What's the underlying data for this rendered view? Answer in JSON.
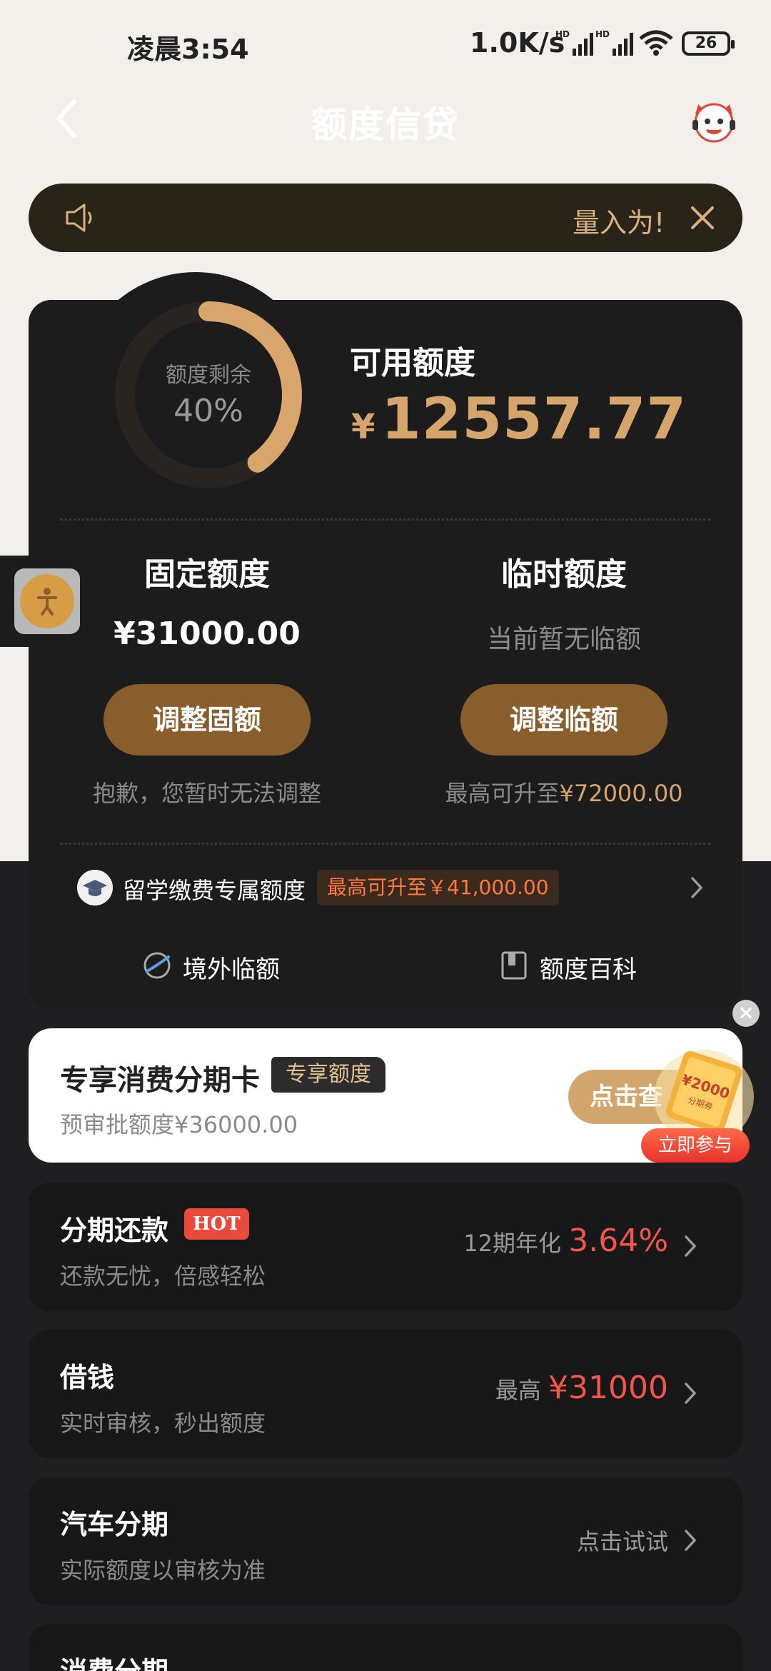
{
  "status_bar": {
    "time": "凌晨3:54",
    "network_speed": "1.0K/s",
    "battery": "26"
  },
  "header": {
    "title": "额度信贷"
  },
  "notice": {
    "text": "量入为!"
  },
  "credit": {
    "ring_label": "额度剩余",
    "ring_percent": "40%",
    "remaining_fraction": 0.4,
    "available_label": "可用额度",
    "currency_symbol": "¥",
    "available_amount": "12557.77"
  },
  "fixed_limit": {
    "title": "固定额度",
    "value": "¥31000.00",
    "button": "调整固额",
    "note": "抱歉，您暂时无法调整"
  },
  "temp_limit": {
    "title": "临时额度",
    "value": "当前暂无临额",
    "button": "调整临额",
    "note_prefix": "最高可升至",
    "note_amount": "¥72000.00"
  },
  "study_abroad": {
    "label": "留学缴费专属额度",
    "badge": "最高可升至￥41,000.00"
  },
  "quick_links": [
    {
      "label": "境外临额",
      "icon": "overseas-icon"
    },
    {
      "label": "额度百科",
      "icon": "book-icon"
    }
  ],
  "promo": {
    "title": "专享消费分期卡",
    "tag": "专享额度",
    "subtitle": "预审批额度¥36000.00",
    "button": "点击查",
    "coupon_amount": "¥2000",
    "coupon_label": "分期券",
    "join": "立即参与"
  },
  "products": [
    {
      "title": "分期还款",
      "badge": "HOT",
      "subtitle": "还款无忧，倍感轻松",
      "right_prefix": "12期年化 ",
      "right_value": "3.64%"
    },
    {
      "title": "借钱",
      "subtitle": "实时审核，秒出额度",
      "right_prefix": "最高 ",
      "right_value": "¥31000"
    },
    {
      "title": "汽车分期",
      "subtitle": "实际额度以审核为准",
      "right_prefix": "点击试试",
      "right_value": ""
    },
    {
      "title": "消费分期"
    }
  ],
  "colors": {
    "gold": "#d6a56c",
    "button_brown": "#8a5d2c",
    "accent_red": "#f2554b",
    "card_dark": "#1c1c1c"
  }
}
